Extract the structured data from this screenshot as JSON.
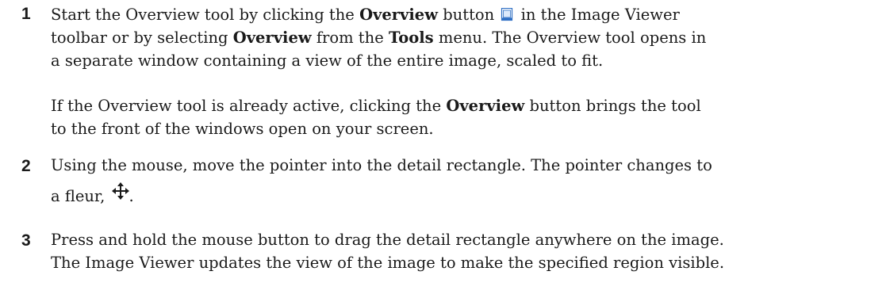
{
  "steps": [
    {
      "number": "1",
      "p1": {
        "l1_a": "Start the Overview tool by clicking the ",
        "l1_b": "Overview",
        "l1_c": " button ",
        "l1_d": " in the Image Viewer",
        "l2_a": "toolbar or by selecting ",
        "l2_b": "Overview",
        "l2_c": " from the ",
        "l2_d": "Tools",
        "l2_e": " menu. The Overview tool opens in",
        "l3": "a separate window containing a view of the entire image, scaled to fit."
      },
      "p2": {
        "l1_a": "If the Overview tool is already active, clicking the ",
        "l1_b": "Overview",
        "l1_c": " button brings the tool",
        "l2": "to the front of the windows open on your screen."
      }
    },
    {
      "number": "2",
      "l1": "Using the mouse, move the pointer into the detail rectangle. The pointer changes to",
      "l2_a": "a fleur, ",
      "l2_b": "."
    },
    {
      "number": "3",
      "l1": "Press and hold the mouse button to drag the detail rectangle anywhere on the image.",
      "l2": "The Image Viewer updates the view of the image to make the specified region visible."
    }
  ],
  "icons": {
    "overview_button": "overview-button-icon",
    "fleur": "fleur-icon"
  },
  "colors": {
    "text": "#1a1a1a",
    "icon_blue": "#2f6fc4"
  }
}
